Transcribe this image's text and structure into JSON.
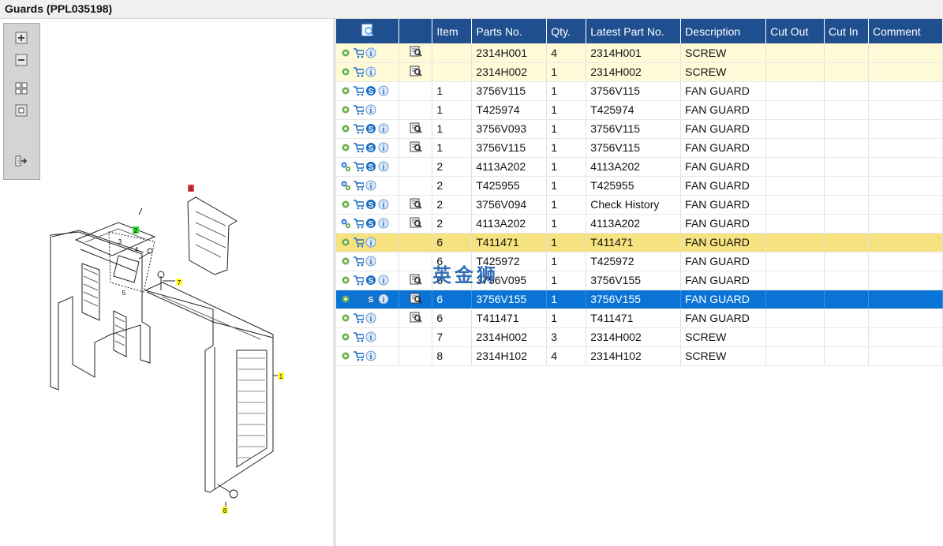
{
  "window": {
    "title": "Guards (PPL035198)"
  },
  "toolbox": {
    "buttons": [
      "zoom-in",
      "zoom-out",
      "fit-all",
      "actual-size",
      "export"
    ]
  },
  "drawing": {
    "callouts": [
      {
        "label": "1",
        "color": "#ffff33"
      },
      {
        "label": "2",
        "color": "#33dd33"
      },
      {
        "label": "3",
        "color": "none"
      },
      {
        "label": "4",
        "color": "none"
      },
      {
        "label": "5",
        "color": "none"
      },
      {
        "label": "6",
        "color": "#ee4444"
      },
      {
        "label": "7",
        "color": "#ffff33"
      },
      {
        "label": "8",
        "color": "#ffff33"
      }
    ]
  },
  "table": {
    "columns": [
      "",
      "",
      "Item",
      "Parts No.",
      "Qty.",
      "Latest Part No.",
      "Description",
      "Cut Out",
      "Cut In",
      "Comment"
    ],
    "rows": [
      {
        "icons": [
          "gear",
          "cart",
          "info"
        ],
        "doc": true,
        "item": "",
        "part": "2314H001",
        "qty": "4",
        "latest": "2314H001",
        "desc": "SCREW",
        "style": "cream"
      },
      {
        "icons": [
          "gear",
          "cart",
          "info"
        ],
        "doc": true,
        "item": "",
        "part": "2314H002",
        "qty": "1",
        "latest": "2314H002",
        "desc": "SCREW",
        "style": "cream"
      },
      {
        "icons": [
          "gear",
          "cart",
          "s",
          "info"
        ],
        "doc": false,
        "item": "1",
        "part": "3756V115",
        "qty": "1",
        "latest": "3756V115",
        "desc": "FAN GUARD",
        "style": ""
      },
      {
        "icons": [
          "gear",
          "cart",
          "info"
        ],
        "doc": false,
        "item": "1",
        "part": "T425974",
        "qty": "1",
        "latest": "T425974",
        "desc": "FAN GUARD",
        "style": ""
      },
      {
        "icons": [
          "gear",
          "cart",
          "s",
          "info"
        ],
        "doc": true,
        "item": "1",
        "part": "3756V093",
        "qty": "1",
        "latest": "3756V115",
        "desc": "FAN GUARD",
        "style": ""
      },
      {
        "icons": [
          "gear",
          "cart",
          "s",
          "info"
        ],
        "doc": true,
        "item": "1",
        "part": "3756V115",
        "qty": "1",
        "latest": "3756V115",
        "desc": "FAN GUARD",
        "style": ""
      },
      {
        "icons": [
          "gears",
          "cart",
          "s",
          "info"
        ],
        "doc": false,
        "item": "2",
        "part": "4113A202",
        "qty": "1",
        "latest": "4113A202",
        "desc": "FAN GUARD",
        "style": ""
      },
      {
        "icons": [
          "gears",
          "cart",
          "info"
        ],
        "doc": false,
        "item": "2",
        "part": "T425955",
        "qty": "1",
        "latest": "T425955",
        "desc": "FAN GUARD",
        "style": ""
      },
      {
        "icons": [
          "gear",
          "cart",
          "s",
          "info"
        ],
        "doc": true,
        "item": "2",
        "part": "3756V094",
        "qty": "1",
        "latest": "Check History",
        "desc": "FAN GUARD",
        "style": ""
      },
      {
        "icons": [
          "gears",
          "cart",
          "s",
          "info"
        ],
        "doc": true,
        "item": "2",
        "part": "4113A202",
        "qty": "1",
        "latest": "4113A202",
        "desc": "FAN GUARD",
        "style": ""
      },
      {
        "icons": [
          "gear",
          "cart",
          "info"
        ],
        "doc": false,
        "item": "6",
        "part": "T411471",
        "qty": "1",
        "latest": "T411471",
        "desc": "FAN GUARD",
        "style": "yellow"
      },
      {
        "icons": [
          "gear",
          "cart",
          "info"
        ],
        "doc": false,
        "item": "6",
        "part": "T425972",
        "qty": "1",
        "latest": "T425972",
        "desc": "FAN GUARD",
        "style": ""
      },
      {
        "icons": [
          "gear",
          "cart",
          "s",
          "info"
        ],
        "doc": true,
        "item": "6",
        "part": "3756V095",
        "qty": "1",
        "latest": "3756V155",
        "desc": "FAN GUARD",
        "style": ""
      },
      {
        "icons": [
          "gear",
          "cart",
          "s",
          "info"
        ],
        "doc": true,
        "item": "6",
        "part": "3756V155",
        "qty": "1",
        "latest": "3756V155",
        "desc": "FAN GUARD",
        "style": "blue"
      },
      {
        "icons": [
          "gear",
          "cart",
          "info"
        ],
        "doc": true,
        "item": "6",
        "part": "T411471",
        "qty": "1",
        "latest": "T411471",
        "desc": "FAN GUARD",
        "style": ""
      },
      {
        "icons": [
          "gear",
          "cart",
          "info"
        ],
        "doc": false,
        "item": "7",
        "part": "2314H002",
        "qty": "3",
        "latest": "2314H002",
        "desc": "SCREW",
        "style": ""
      },
      {
        "icons": [
          "gear",
          "cart",
          "info"
        ],
        "doc": false,
        "item": "8",
        "part": "2314H102",
        "qty": "4",
        "latest": "2314H102",
        "desc": "SCREW",
        "style": ""
      }
    ]
  },
  "watermark": "英金狮",
  "colors": {
    "header": "#1f4f8f",
    "selected": "#0a74d6",
    "highlight": "#f6e27e",
    "cream": "#fffbd9"
  }
}
